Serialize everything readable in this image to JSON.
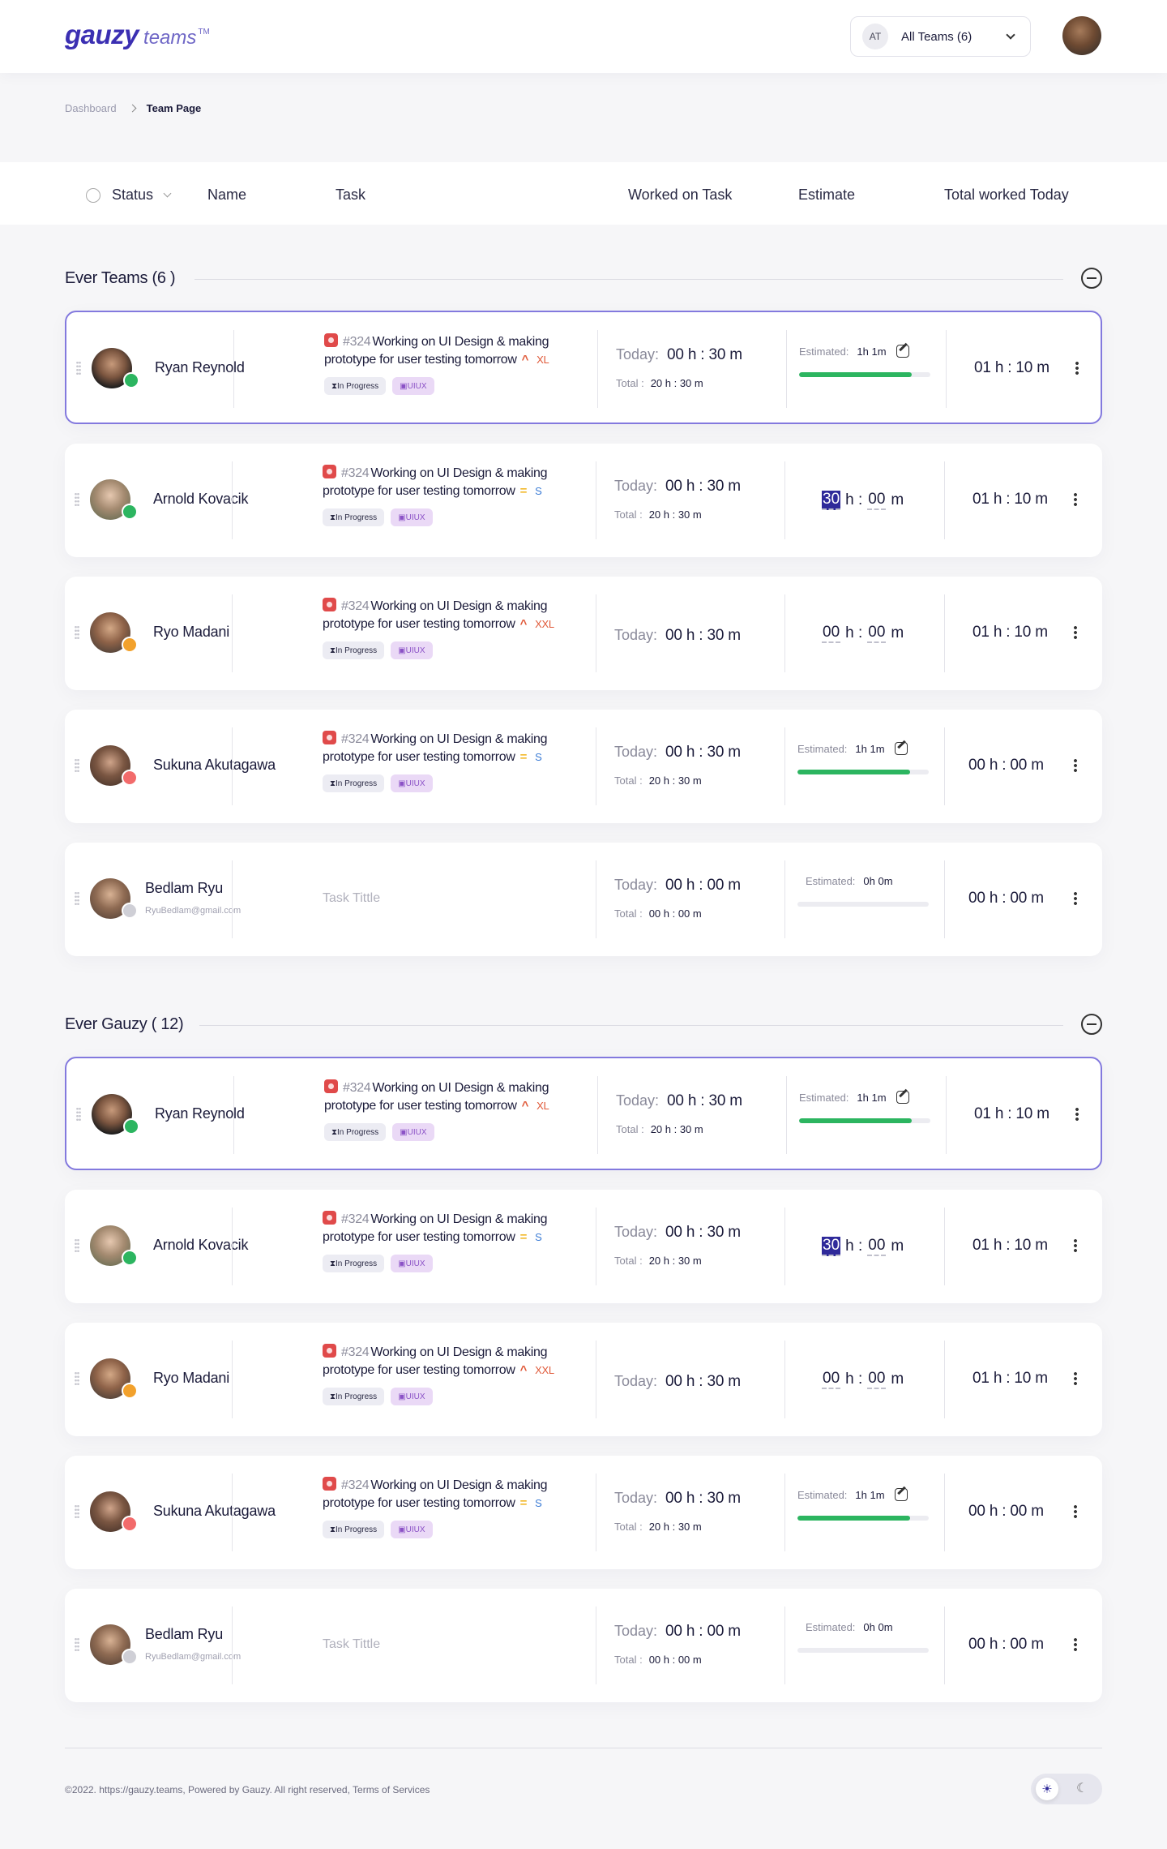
{
  "header": {
    "brand": "gauzy",
    "brand_sub": "teams",
    "brand_tm": "TM",
    "team_initials": "AT",
    "team_label": "All Teams (6)"
  },
  "breadcrumb": {
    "parent": "Dashboard",
    "current": "Team Page"
  },
  "columns": {
    "status": "Status",
    "name": "Name",
    "task": "Task",
    "worked": "Worked on Task",
    "estimate": "Estimate",
    "total": "Total worked Today"
  },
  "sections": [
    {
      "title": "Ever Teams (6 )",
      "rows": [
        {
          "name": "Ryan Reynold",
          "email": "",
          "status_color": "#2cb560",
          "task_num": "#324",
          "task_title": "Working on UI Design & making",
          "task_line2": "prototype for user testing tomorrow",
          "priority": "high",
          "size": "XL",
          "size_color": "#e05a3a",
          "tag_status": "In Progress",
          "tag_label": "UIUX",
          "today_label": "Today:",
          "today": "00 h : 30 m",
          "total_label": "Total :",
          "total": "20 h : 30 m",
          "est_mode": "bar",
          "est_label": "Estimated:",
          "est_value": "1h 1m",
          "progress": 0.86,
          "worked_today": "01 h : 10 m",
          "active": true
        },
        {
          "name": "Arnold Kovacik",
          "email": "",
          "status_color": "#2cb560",
          "task_num": "#324",
          "task_title": "Working on UI Design & making",
          "task_line2": "prototype for user testing tomorrow",
          "priority": "med",
          "size": "S",
          "size_color": "#3a7bd5",
          "tag_status": "In Progress",
          "tag_label": "UIUX",
          "today_label": "Today:",
          "today": "00 h : 30 m",
          "total_label": "Total :",
          "total": "20 h : 30 m",
          "est_mode": "input",
          "est_h": "30",
          "est_h_sel": true,
          "est_m": "00",
          "worked_today": "01 h : 10 m"
        },
        {
          "name": "Ryo Madani",
          "email": "",
          "status_color": "#f2a12c",
          "task_num": "#324",
          "task_title": "Working on UI Design & making",
          "task_line2": "prototype for user testing tomorrow",
          "priority": "high",
          "size": "XXL",
          "size_color": "#e05a3a",
          "tag_status": "In Progress",
          "tag_label": "UIUX",
          "today_label": "Today:",
          "today": "00 h : 30 m",
          "total_label": "",
          "total": "",
          "est_mode": "input",
          "est_h": "00",
          "est_h_sel": false,
          "est_m": "00",
          "worked_today": "01 h : 10 m"
        },
        {
          "name": "Sukuna Akutagawa",
          "email": "",
          "status_color": "#f26b6b",
          "task_num": "#324",
          "task_title": "Working on UI Design & making",
          "task_line2": "prototype for user testing tomorrow",
          "priority": "med",
          "size": "S",
          "size_color": "#3a7bd5",
          "tag_status": "In Progress",
          "tag_label": "UIUX",
          "today_label": "Today:",
          "today": "00 h : 30 m",
          "total_label": "Total :",
          "total": "20 h : 30 m",
          "est_mode": "bar",
          "est_label": "Estimated:",
          "est_value": "1h 1m",
          "progress": 0.86,
          "worked_today": "00 h : 00 m"
        },
        {
          "name": "Bedlam Ryu",
          "email": "RyuBedlam@gmail.com",
          "status_color": "#cfcfd6",
          "task_placeholder": "Task Tittle",
          "today_label": "Today:",
          "today": "00 h : 00 m",
          "total_label": "Total :",
          "total": "00 h : 00 m",
          "est_mode": "bar",
          "est_label": "Estimated:",
          "est_value": "0h 0m",
          "progress": 0,
          "no_edit": true,
          "worked_today": "00 h : 00 m"
        }
      ]
    },
    {
      "title": "Ever Gauzy ( 12)",
      "rows": [
        {
          "name": "Ryan Reynold",
          "email": "",
          "status_color": "#2cb560",
          "task_num": "#324",
          "task_title": "Working on UI Design & making",
          "task_line2": "prototype for user testing tomorrow",
          "priority": "high",
          "size": "XL",
          "size_color": "#e05a3a",
          "tag_status": "In Progress",
          "tag_label": "UIUX",
          "today_label": "Today:",
          "today": "00 h : 30 m",
          "total_label": "Total :",
          "total": "20 h : 30 m",
          "est_mode": "bar",
          "est_label": "Estimated:",
          "est_value": "1h 1m",
          "progress": 0.86,
          "worked_today": "01 h : 10 m",
          "active": true
        },
        {
          "name": "Arnold Kovacik",
          "email": "",
          "status_color": "#2cb560",
          "task_num": "#324",
          "task_title": "Working on UI Design & making",
          "task_line2": "prototype for user testing tomorrow",
          "priority": "med",
          "size": "S",
          "size_color": "#3a7bd5",
          "tag_status": "In Progress",
          "tag_label": "UIUX",
          "today_label": "Today:",
          "today": "00 h : 30 m",
          "total_label": "Total :",
          "total": "20 h : 30 m",
          "est_mode": "input",
          "est_h": "30",
          "est_h_sel": true,
          "est_m": "00",
          "worked_today": "01 h : 10 m"
        },
        {
          "name": "Ryo Madani",
          "email": "",
          "status_color": "#f2a12c",
          "task_num": "#324",
          "task_title": "Working on UI Design & making",
          "task_line2": "prototype for user testing tomorrow",
          "priority": "high",
          "size": "XXL",
          "size_color": "#e05a3a",
          "tag_status": "In Progress",
          "tag_label": "UIUX",
          "today_label": "Today:",
          "today": "00 h : 30 m",
          "total_label": "",
          "total": "",
          "est_mode": "input",
          "est_h": "00",
          "est_h_sel": false,
          "est_m": "00",
          "worked_today": "01 h : 10 m"
        },
        {
          "name": "Sukuna Akutagawa",
          "email": "",
          "status_color": "#f26b6b",
          "task_num": "#324",
          "task_title": "Working on UI Design & making",
          "task_line2": "prototype for user testing tomorrow",
          "priority": "med",
          "size": "S",
          "size_color": "#3a7bd5",
          "tag_status": "In Progress",
          "tag_label": "UIUX",
          "today_label": "Today:",
          "today": "00 h : 30 m",
          "total_label": "Total :",
          "total": "20 h : 30 m",
          "est_mode": "bar",
          "est_label": "Estimated:",
          "est_value": "1h 1m",
          "progress": 0.86,
          "worked_today": "00 h : 00 m"
        },
        {
          "name": "Bedlam Ryu",
          "email": "RyuBedlam@gmail.com",
          "status_color": "#cfcfd6",
          "task_placeholder": "Task Tittle",
          "today_label": "Today:",
          "today": "00 h : 00 m",
          "total_label": "Total :",
          "total": "00 h : 00 m",
          "est_mode": "bar",
          "est_label": "Estimated:",
          "est_value": "0h 0m",
          "progress": 0,
          "no_edit": true,
          "worked_today": "00 h : 00 m"
        }
      ]
    }
  ],
  "footer": {
    "text": "©2022. https://gauzy.teams, Powered by Gauzy. All right reserved, Terms of Services"
  },
  "colors": {
    "accent": "#3b2fb2",
    "active_border": "#8379de",
    "progress": "#2cb560"
  }
}
